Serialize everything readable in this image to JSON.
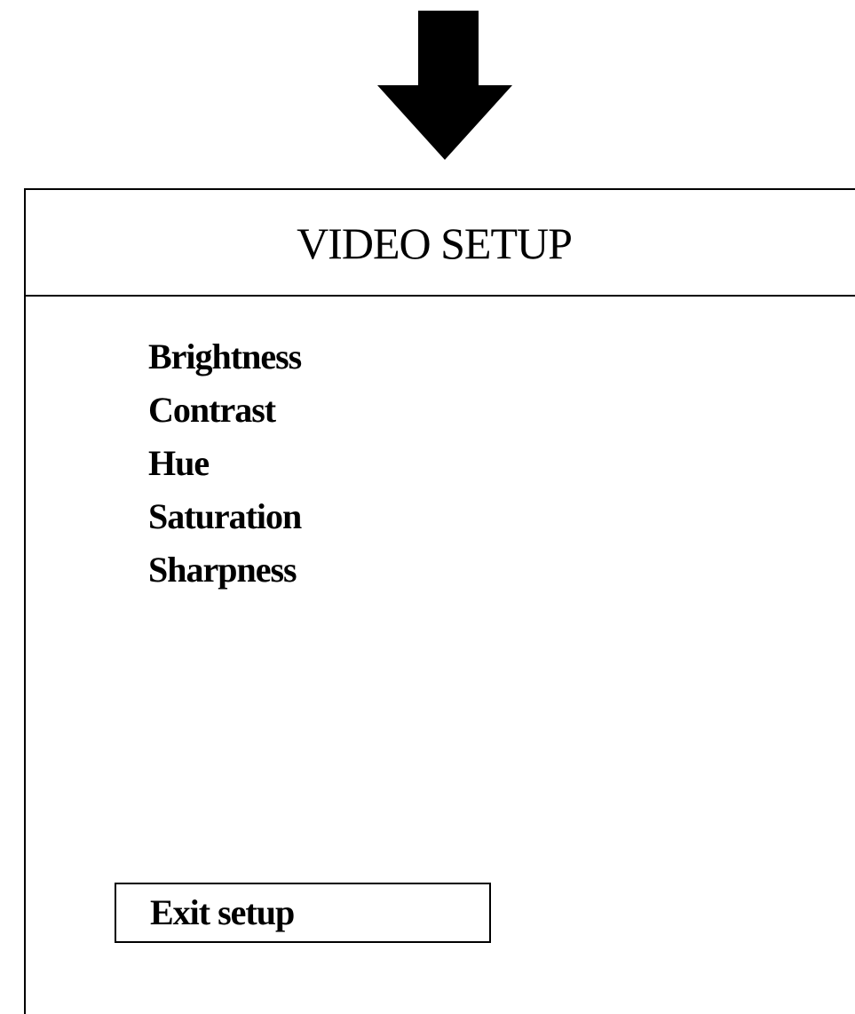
{
  "indicator": {
    "icon": "down-arrow-icon",
    "color": "#000000"
  },
  "video_setup": {
    "title": "VIDEO SETUP",
    "items": [
      {
        "label": "Brightness"
      },
      {
        "label": "Contrast"
      },
      {
        "label": "Hue"
      },
      {
        "label": "Saturation"
      },
      {
        "label": "Sharpness"
      }
    ],
    "exit_label": "Exit setup"
  }
}
